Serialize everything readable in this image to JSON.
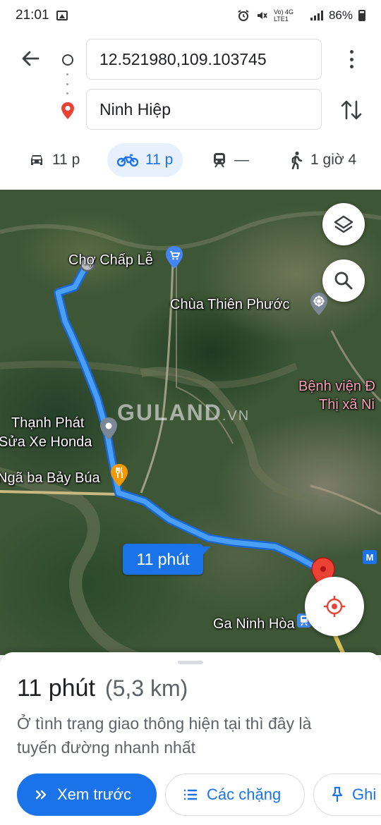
{
  "status_bar": {
    "time": "21:01",
    "network": "Vo) 4G LTE1",
    "battery": "86%"
  },
  "route": {
    "origin_value": "12.521980,109.103745",
    "destination_value": "Ninh Hiệp"
  },
  "modes": [
    {
      "name": "car",
      "label": "11 p"
    },
    {
      "name": "motorbike",
      "label": "11 p",
      "selected": true
    },
    {
      "name": "transit",
      "label": "—"
    },
    {
      "name": "walk",
      "label": "1 giờ 4"
    }
  ],
  "map": {
    "labels": {
      "cho_chap_le": "Chợ Chấp Lễ",
      "chua_thien_phuoc": "Chùa Thiên Phước",
      "benh_vien_1": "Bệnh viện Đ",
      "benh_vien_2": "Thị xã Ni",
      "thanh_phat_1": "Thạnh Phát",
      "thanh_phat_2": "Sửa Xe Honda",
      "nga_ba": "Ngã ba Bảy Búa",
      "ga_ninh_hoa": "Ga Ninh Hòa"
    },
    "watermark": "GULAND",
    "watermark_suffix": ".VN",
    "route_badge": "11 phút",
    "metro_label": "M",
    "colors": {
      "route": "#4285f4",
      "route_outline": "#1967d2",
      "destination_pin": "#ea4335"
    }
  },
  "sheet": {
    "duration": "11 phút",
    "distance": "(5,3 km)",
    "description": "Ở tình trạng giao thông hiện tại thì đây là tuyến đường nhanh nhất",
    "preview_label": "Xem trước",
    "steps_label": "Các chặng",
    "save_label": "Ghi"
  },
  "icons": [
    "image-icon",
    "alarm-icon",
    "mute-icon",
    "signal-icon",
    "battery-icon",
    "back-arrow-icon",
    "origin-circle-icon",
    "destination-pin-icon",
    "more-vert-icon",
    "swap-icon",
    "car-icon",
    "motorbike-icon",
    "train-icon",
    "walk-icon",
    "layers-icon",
    "search-icon",
    "my-location-icon",
    "shopping-cart-icon",
    "temple-icon",
    "restaurant-icon",
    "train-station-icon",
    "chevrons-right-icon",
    "list-icon",
    "pin-icon"
  ]
}
